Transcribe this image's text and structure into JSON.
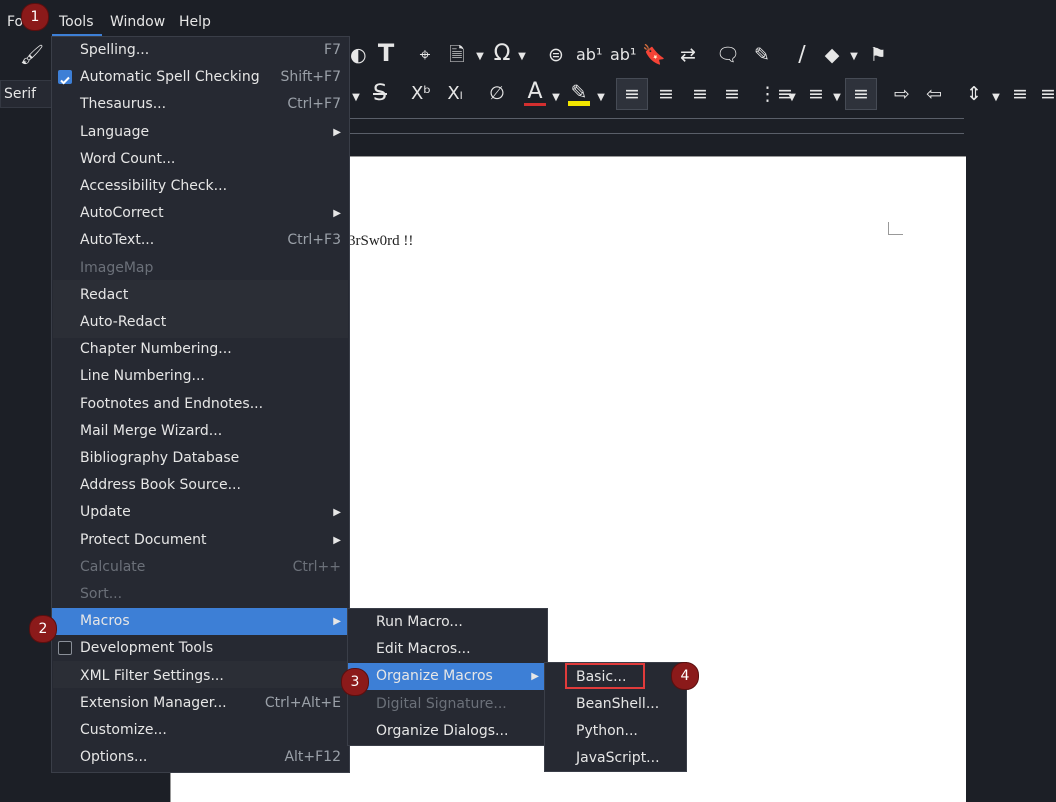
{
  "menubar": {
    "items": [
      {
        "label": "Fo"
      },
      {
        "label": "Tools"
      },
      {
        "label": "Window"
      },
      {
        "label": "Help"
      }
    ]
  },
  "toolbar": {
    "font_name": "Serif",
    "colors": {
      "font_color": "#d32f2f",
      "highlight_color": "#f2e600"
    }
  },
  "document": {
    "text": "3rSw0rd !!"
  },
  "tools_menu": {
    "items": [
      {
        "label": "Spelling...",
        "shortcut": "F7"
      },
      {
        "label": "Automatic Spell Checking",
        "shortcut": "Shift+F7",
        "checked": true
      },
      {
        "label": "Thesaurus...",
        "shortcut": "Ctrl+F7"
      },
      {
        "label": "Language",
        "submenu": true
      },
      {
        "label": "Word Count..."
      },
      {
        "label": "Accessibility Check..."
      },
      {
        "label": "AutoCorrect",
        "submenu": true
      },
      {
        "label": "AutoText...",
        "shortcut": "Ctrl+F3"
      },
      {
        "label": "ImageMap",
        "disabled": true
      },
      {
        "label": "Redact"
      },
      {
        "label": "Auto-Redact"
      },
      {
        "label": "Chapter Numbering..."
      },
      {
        "label": "Line Numbering..."
      },
      {
        "label": "Footnotes and Endnotes..."
      },
      {
        "label": "Mail Merge Wizard..."
      },
      {
        "label": "Bibliography Database"
      },
      {
        "label": "Address Book Source..."
      },
      {
        "label": "Update",
        "submenu": true
      },
      {
        "label": "Protect Document",
        "submenu": true
      },
      {
        "label": "Calculate",
        "shortcut": "Ctrl++",
        "disabled": true
      },
      {
        "label": "Sort...",
        "disabled": true
      },
      {
        "label": "Macros",
        "submenu": true,
        "highlighted": true
      },
      {
        "label": "Development Tools",
        "checked": false
      },
      {
        "label": "XML Filter Settings..."
      },
      {
        "label": "Extension Manager...",
        "shortcut": "Ctrl+Alt+E"
      },
      {
        "label": "Customize..."
      },
      {
        "label": "Options...",
        "shortcut": "Alt+F12"
      }
    ]
  },
  "macros_menu": {
    "items": [
      {
        "label": "Run Macro..."
      },
      {
        "label": "Edit Macros..."
      },
      {
        "label": "Organize Macros",
        "submenu": true,
        "highlighted": true
      },
      {
        "label": "Digital Signature...",
        "disabled": true
      },
      {
        "label": "Organize Dialogs..."
      }
    ]
  },
  "organize_menu": {
    "items": [
      {
        "label": "Basic..."
      },
      {
        "label": "BeanShell..."
      },
      {
        "label": "Python..."
      },
      {
        "label": "JavaScript..."
      }
    ]
  },
  "annotations": {
    "steps": [
      "1",
      "2",
      "3",
      "4"
    ]
  }
}
